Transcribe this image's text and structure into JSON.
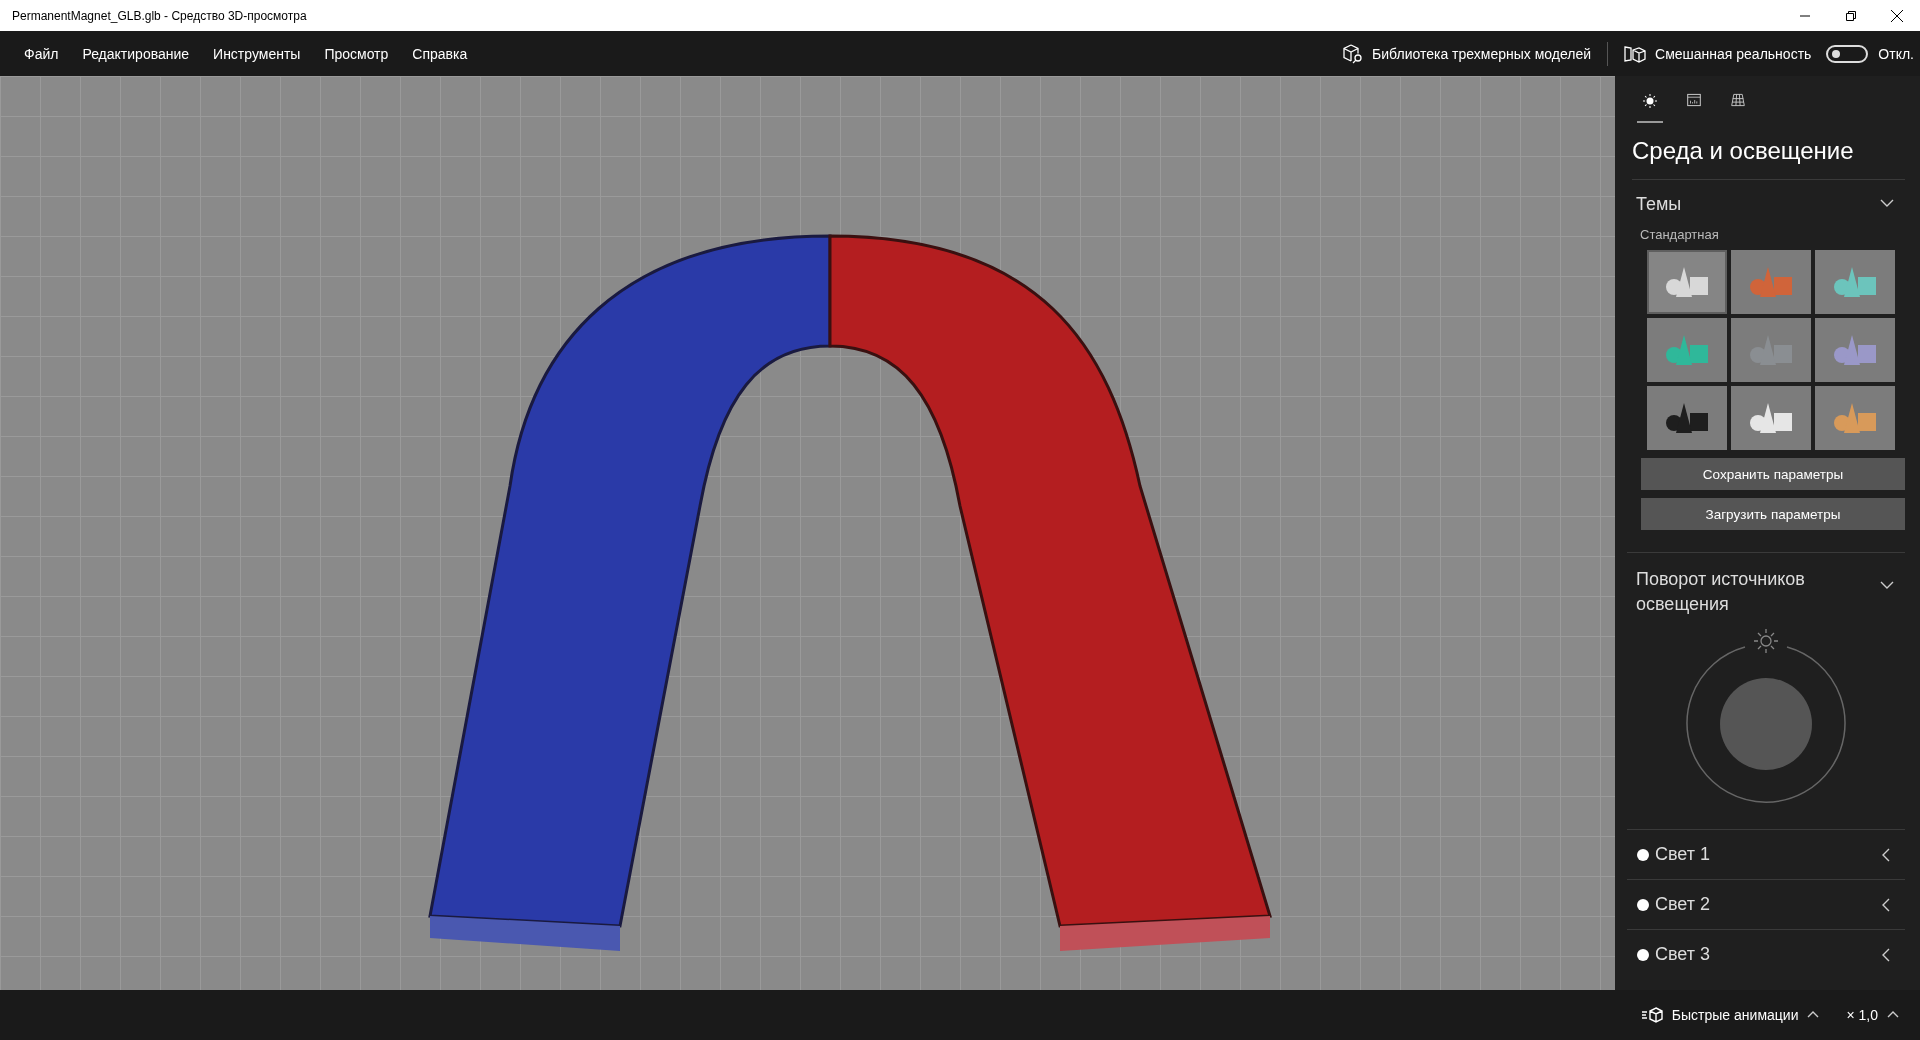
{
  "window": {
    "title": "PermanentMagnet_GLB.glb - Средство 3D-просмотра"
  },
  "menu": [
    "Файл",
    "Редактирование",
    "Инструменты",
    "Просмотр",
    "Справка"
  ],
  "toolbar": {
    "library": "Библиотека трехмерных моделей",
    "mixed_reality": {
      "label": "Смешанная реальность",
      "on": false,
      "state_text": "Откл."
    }
  },
  "panel": {
    "tabs": [
      {
        "kind": "sun",
        "selected": true
      },
      {
        "kind": "stats",
        "selected": false
      },
      {
        "kind": "grid",
        "selected": false
      }
    ],
    "title": "Среда и освещение",
    "themes": {
      "title": "Темы",
      "expanded": true,
      "subtitle": "Стандартная",
      "items": [
        {
          "color": "#d8d8d8",
          "selected": true
        },
        {
          "color": "#d0643a",
          "selected": false
        },
        {
          "color": "#6cc4bc",
          "selected": false
        },
        {
          "color": "#2fb89a",
          "selected": false
        },
        {
          "color": "#8a8e92",
          "selected": false
        },
        {
          "color": "#9a98c8",
          "selected": false
        },
        {
          "color": "#1e1e1e",
          "selected": false
        },
        {
          "color": "#e6e6e6",
          "selected": false
        },
        {
          "color": "#d89a5a",
          "selected": false
        }
      ]
    },
    "buttons": [
      "Сохранить параметры",
      "Загрузить параметры"
    ],
    "rotation": {
      "title": "Поворот источников освещения",
      "expanded": true
    },
    "lights": [
      {
        "label": "Свет 1"
      },
      {
        "label": "Свет 2"
      },
      {
        "label": "Свет 3"
      }
    ]
  },
  "status_bar": {
    "animations": "Быстрые анимации",
    "speed": "× 1,0"
  }
}
